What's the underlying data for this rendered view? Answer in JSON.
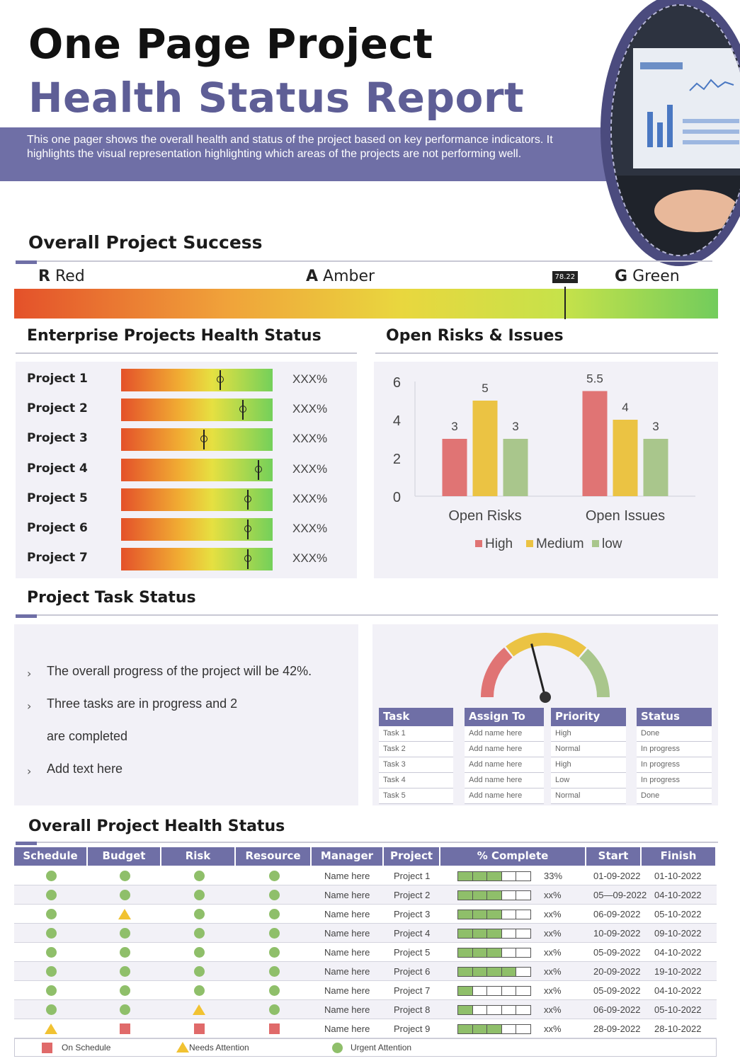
{
  "header": {
    "title_line1": "One Page Project",
    "title_line2": "Health Status Report",
    "description": "This one pager shows the overall health and status of the project based on key performance indicators. It highlights the visual representation highlighting which areas of the projects are not performing well."
  },
  "overall_success": {
    "title": "Overall Project Success",
    "labels": [
      {
        "letter": "R",
        "text": "Red"
      },
      {
        "letter": "A",
        "text": "Amber"
      },
      {
        "letter": "G",
        "text": "Green"
      }
    ],
    "marker_value": "78.22",
    "marker_fraction": 0.7822
  },
  "enterprise": {
    "title": "Enterprise Projects Health Status",
    "projects": [
      {
        "name": "Project 1",
        "pct": "XXX%",
        "level": 0.65
      },
      {
        "name": "Project 2",
        "pct": "XXX%",
        "level": 0.8
      },
      {
        "name": "Project 3",
        "pct": "XXX%",
        "level": 0.54
      },
      {
        "name": "Project 4",
        "pct": "XXX%",
        "level": 0.9
      },
      {
        "name": "Project 5",
        "pct": "XXX%",
        "level": 0.83
      },
      {
        "name": "Project 6",
        "pct": "XXX%",
        "level": 0.83
      },
      {
        "name": "Project 7",
        "pct": "XXX%",
        "level": 0.83
      }
    ]
  },
  "risks": {
    "title": "Open Risks & Issues"
  },
  "chart_data": {
    "type": "bar",
    "categories": [
      "Open Risks",
      "Open Issues"
    ],
    "series": [
      {
        "name": "High",
        "values": [
          3,
          5.5
        ],
        "color": "#e07474"
      },
      {
        "name": "Medium",
        "values": [
          5,
          4
        ],
        "color": "#ebc343"
      },
      {
        "name": "low",
        "values": [
          3,
          3
        ],
        "color": "#a9c68c"
      }
    ],
    "yticks": [
      "0",
      "2",
      "4",
      "6"
    ],
    "ylim": [
      0,
      6
    ],
    "data_labels": [
      [
        "3",
        "5",
        "3"
      ],
      [
        "5.5",
        "4",
        "3"
      ]
    ],
    "legend": "bottom"
  },
  "task_status": {
    "title": "Project Task Status",
    "bullets": [
      "The overall progress of the project will be 42%.",
      "Three tasks are in progress and 2",
      "are completed",
      "Add text here"
    ],
    "gauge_level": 0.42,
    "table": {
      "headers": [
        "Task",
        "Assign To",
        "Priority",
        "Status"
      ],
      "rows": [
        [
          "Task 1",
          "Add name here",
          "High",
          "Done"
        ],
        [
          "Task 2",
          "Add name here",
          "Normal",
          "In progress"
        ],
        [
          "Task 3",
          "Add name here",
          "High",
          "In progress"
        ],
        [
          "Task 4",
          "Add name here",
          "Low",
          "In progress"
        ],
        [
          "Task 5",
          "Add name here",
          "Normal",
          "Done"
        ]
      ]
    }
  },
  "overall_health": {
    "title": "Overall Project Health Status",
    "headers": [
      "Schedule",
      "Budget",
      "Risk",
      "Resource",
      "Manager",
      "Project",
      "% Complete",
      "Start",
      "Finish"
    ],
    "rows": [
      {
        "schedule": "green",
        "budget": "green",
        "risk": "green",
        "resource": "green",
        "manager": "Name here",
        "project": "Project 1",
        "filled": 3,
        "pct": "33%",
        "start": "01-09-2022",
        "finish": "01-10-2022"
      },
      {
        "schedule": "green",
        "budget": "green",
        "risk": "green",
        "resource": "green",
        "manager": "Name here",
        "project": "Project 2",
        "filled": 3,
        "pct": "xx%",
        "start": "05—09-2022",
        "finish": "04-10-2022"
      },
      {
        "schedule": "green",
        "budget": "amber",
        "risk": "green",
        "resource": "green",
        "manager": "Name here",
        "project": "Project 3",
        "filled": 3,
        "pct": "xx%",
        "start": "06-09-2022",
        "finish": "05-10-2022"
      },
      {
        "schedule": "green",
        "budget": "green",
        "risk": "green",
        "resource": "green",
        "manager": "Name here",
        "project": "Project 4",
        "filled": 3,
        "pct": "xx%",
        "start": "10-09-2022",
        "finish": "09-10-2022"
      },
      {
        "schedule": "green",
        "budget": "green",
        "risk": "green",
        "resource": "green",
        "manager": "Name here",
        "project": "Project 5",
        "filled": 3,
        "pct": "xx%",
        "start": "05-09-2022",
        "finish": "04-10-2022"
      },
      {
        "schedule": "green",
        "budget": "green",
        "risk": "green",
        "resource": "green",
        "manager": "Name here",
        "project": "Project 6",
        "filled": 4,
        "pct": "xx%",
        "start": "20-09-2022",
        "finish": "19-10-2022"
      },
      {
        "schedule": "green",
        "budget": "green",
        "risk": "green",
        "resource": "green",
        "manager": "Name here",
        "project": "Project 7",
        "filled": 1,
        "pct": "xx%",
        "start": "05-09-2022",
        "finish": "04-10-2022"
      },
      {
        "schedule": "green",
        "budget": "green",
        "risk": "amber",
        "resource": "green",
        "manager": "Name here",
        "project": "Project 8",
        "filled": 1,
        "pct": "xx%",
        "start": "06-09-2022",
        "finish": "05-10-2022"
      },
      {
        "schedule": "amber",
        "budget": "red",
        "risk": "red",
        "resource": "red",
        "manager": "Name here",
        "project": "Project 9",
        "filled": 3,
        "pct": "xx%",
        "start": "28-09-2022",
        "finish": "28-10-2022"
      }
    ],
    "legend": {
      "on_schedule": "On Schedule",
      "needs_attention": "Needs Attention",
      "urgent_attention": "Urgent Attention"
    }
  },
  "colors": {
    "accent": "#6f6fa6",
    "green": "#8fbf6a",
    "amber": "#f1c232",
    "red": "#e06a6a"
  }
}
